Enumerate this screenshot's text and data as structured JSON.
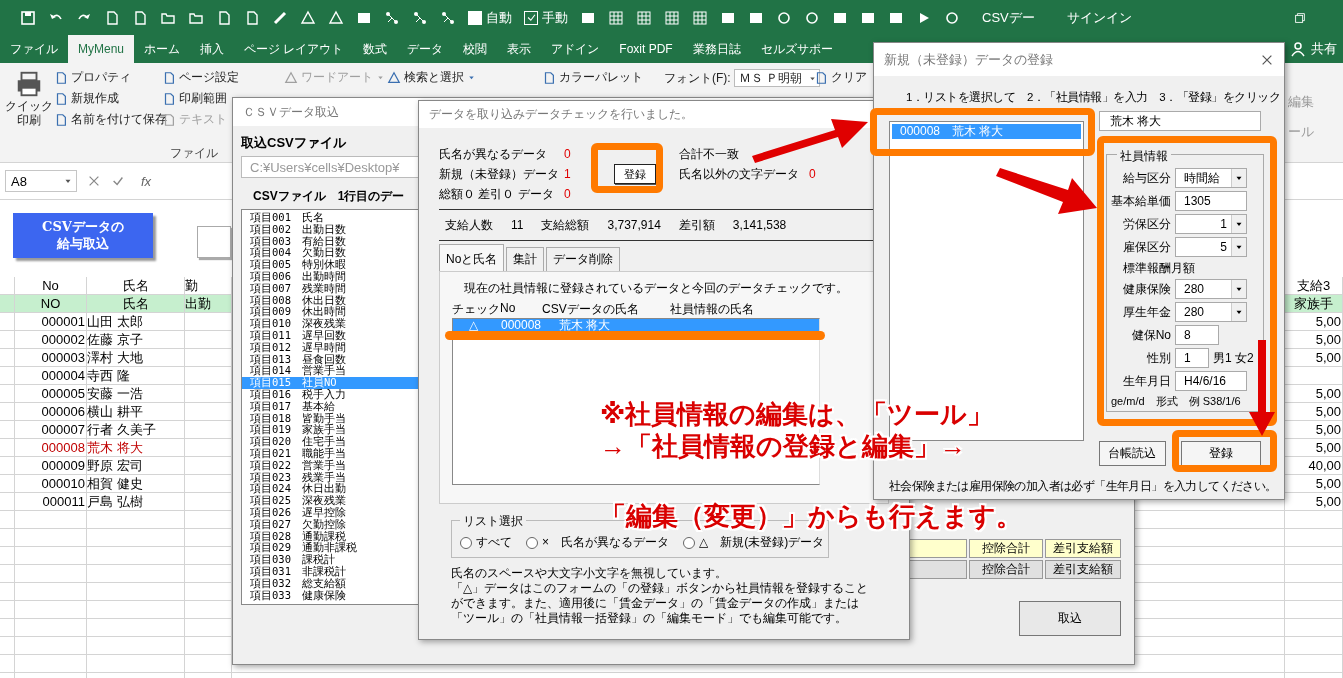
{
  "excel": {
    "title": "CSVデー",
    "signin": "サインイン",
    "share": "共有",
    "toggles": [
      {
        "label": "自動",
        "checked": false
      },
      {
        "label": "手動",
        "checked": true
      }
    ],
    "tabs": [
      {
        "label": "ファイル",
        "selected": false
      },
      {
        "label": "MyMenu",
        "selected": true
      },
      {
        "label": "ホーム",
        "selected": false
      },
      {
        "label": "挿入",
        "selected": false
      },
      {
        "label": "ページ レイアウト",
        "selected": false
      },
      {
        "label": "数式",
        "selected": false
      },
      {
        "label": "データ",
        "selected": false
      },
      {
        "label": "校閲",
        "selected": false
      },
      {
        "label": "表示",
        "selected": false
      },
      {
        "label": "アドイン",
        "selected": false
      },
      {
        "label": "Foxit PDF",
        "selected": false
      },
      {
        "label": "業務日誌",
        "selected": false
      },
      {
        "label": "セルズサポー",
        "selected": false
      }
    ]
  },
  "ribbon": {
    "columns": [
      [
        {
          "label": "クイック印刷",
          "kind": "large",
          "disabled": false
        }
      ],
      [
        {
          "label": "プロパティ",
          "kind": "small",
          "disabled": false
        },
        {
          "label": "新規作成",
          "kind": "small",
          "disabled": false
        },
        {
          "label": "名前を付けて保存",
          "kind": "small",
          "disabled": false
        }
      ],
      [
        {
          "label": "ページ設定",
          "kind": "small",
          "disabled": false
        },
        {
          "label": "印刷範囲",
          "kind": "small",
          "disabled": false
        },
        {
          "label": "テキスト",
          "kind": "small",
          "disabled": true
        }
      ],
      [
        {
          "label": "ワードアート",
          "kind": "menu",
          "disabled": true
        }
      ],
      [
        {
          "label": "検索と選択",
          "kind": "menu",
          "disabled": false
        }
      ],
      [
        {
          "label": "カラーパレット",
          "kind": "small",
          "disabled": false
        }
      ],
      [
        {
          "label": "フォント(F):",
          "kind": "font",
          "value": "ＭＳ Ｐ明朝",
          "disabled": false
        }
      ],
      [
        {
          "label": "クリア",
          "kind": "small",
          "disabled": false
        }
      ]
    ],
    "group_label": "ファイル",
    "partial": [
      "編集",
      "ール"
    ]
  },
  "formula_bar": {
    "name_box": "A8",
    "fx": "fx"
  },
  "sheet": {
    "button": "CSVデータの給与取込",
    "headers": [
      {
        "cells": [
          "No",
          "氏名",
          "勤",
          "支給3"
        ],
        "highlight": false
      },
      {
        "cells": [
          "NO",
          "氏名",
          "出勤",
          "家族手"
        ],
        "highlight": true
      }
    ],
    "rows": [
      {
        "no": "000001",
        "name": "山田 太郎",
        "amount": "5,00",
        "unregistered": false
      },
      {
        "no": "000002",
        "name": "佐藤 京子",
        "amount": "5,00",
        "unregistered": false
      },
      {
        "no": "000003",
        "name": "澤村 大地",
        "amount": "5,00",
        "unregistered": false
      },
      {
        "no": "000004",
        "name": "寺西 隆",
        "unregistered": false
      },
      {
        "no": "000005",
        "name": "安藤 一浩",
        "amount": "5,00",
        "unregistered": false
      },
      {
        "no": "000006",
        "name": "横山 耕平",
        "amount": "5,00",
        "unregistered": false
      },
      {
        "no": "000007",
        "name": "行者 久美子",
        "amount": "5,00",
        "unregistered": false
      },
      {
        "no": "000008",
        "name": "荒木 将大",
        "amount": "5,00",
        "unregistered": true
      },
      {
        "no": "000009",
        "name": "野原 宏司",
        "amount": "40,00",
        "unregistered": false
      },
      {
        "no": "000010",
        "name": "相賀 健史",
        "amount": "5,00",
        "unregistered": false
      },
      {
        "no": "000011",
        "name": "戸島 弘樹",
        "amount": "5,00",
        "unregistered": false
      }
    ]
  },
  "csv_window": {
    "title": "ＣＳＶデータ取込",
    "file_label": "取込CSVファイル",
    "file_path": "C:¥Users¥cells¥Desktop¥",
    "list_label": "CSVファイル　1行目のデー",
    "fields": [
      {
        "no": "項目001",
        "name": "氏名",
        "selected": false
      },
      {
        "no": "項目002",
        "name": "出勤日数",
        "selected": false
      },
      {
        "no": "項目003",
        "name": "有給日数",
        "selected": false
      },
      {
        "no": "項目004",
        "name": "欠勤日数",
        "selected": false
      },
      {
        "no": "項目005",
        "name": "特別休暇",
        "selected": false
      },
      {
        "no": "項目006",
        "name": "出勤時間",
        "selected": false
      },
      {
        "no": "項目007",
        "name": "残業時間",
        "selected": false
      },
      {
        "no": "項目008",
        "name": "休出日数",
        "selected": false
      },
      {
        "no": "項目009",
        "name": "休出時間",
        "selected": false
      },
      {
        "no": "項目010",
        "name": "深夜残業",
        "selected": false
      },
      {
        "no": "項目011",
        "name": "遅早回数",
        "selected": false
      },
      {
        "no": "項目012",
        "name": "遅早時間",
        "selected": false
      },
      {
        "no": "項目013",
        "name": "昼食回数",
        "selected": false
      },
      {
        "no": "項目014",
        "name": "営業手当",
        "selected": false
      },
      {
        "no": "項目015",
        "name": "社員NO",
        "selected": true
      },
      {
        "no": "項目016",
        "name": "税手入力",
        "selected": false
      },
      {
        "no": "項目017",
        "name": "基本給",
        "selected": false
      },
      {
        "no": "項目018",
        "name": "皆勤手当",
        "selected": false
      },
      {
        "no": "項目019",
        "name": "家族手当",
        "selected": false
      },
      {
        "no": "項目020",
        "name": "住宅手当",
        "selected": false
      },
      {
        "no": "項目021",
        "name": "職能手当",
        "selected": false
      },
      {
        "no": "項目022",
        "name": "営業手当",
        "selected": false
      },
      {
        "no": "項目023",
        "name": "残業手当",
        "selected": false
      },
      {
        "no": "項目024",
        "name": "休日出勤",
        "selected": false
      },
      {
        "no": "項目025",
        "name": "深夜残業",
        "selected": false
      },
      {
        "no": "項目026",
        "name": "遅早控除",
        "selected": false
      },
      {
        "no": "項目027",
        "name": "欠勤控除",
        "selected": false
      },
      {
        "no": "項目028",
        "name": "通勤課税",
        "selected": false
      },
      {
        "no": "項目029",
        "name": "通勤非課税",
        "selected": false
      },
      {
        "no": "項目030",
        "name": "課税計",
        "selected": false
      },
      {
        "no": "項目031",
        "name": "非課税計",
        "selected": false
      },
      {
        "no": "項目032",
        "name": "総支給額",
        "selected": false
      },
      {
        "no": "項目033",
        "name": "健康保険",
        "selected": false
      }
    ],
    "summary_rows": [
      {
        "cells": [
          "控除合計",
          "差引支給額"
        ],
        "highlight": true
      },
      {
        "cells": [
          "控除合計",
          "差引支給額"
        ],
        "highlight": false
      }
    ],
    "import_button": "取込"
  },
  "check_dialog": {
    "title": "データを取り込みデータチェックを行いました。",
    "checks_left": [
      {
        "label": "氏名が異なるデータ",
        "count": "0"
      },
      {
        "label": "新規（未登録）データ",
        "count": "1"
      },
      {
        "label": "総額０ 差引０ データ",
        "count": "0"
      }
    ],
    "register_button": "登録",
    "checks_right": [
      {
        "label": "合計不一致"
      },
      {
        "label": "氏名以外の文字データ",
        "count": "0"
      }
    ],
    "totals": [
      {
        "label": "支給人数",
        "value": "11"
      },
      {
        "label": "支給総額",
        "value": "3,737,914"
      },
      {
        "label": "差引額",
        "value": "3,141,538"
      }
    ],
    "tabs": [
      {
        "label": "Noと氏名",
        "selected": true
      },
      {
        "label": "集計",
        "selected": false
      },
      {
        "label": "データ削除",
        "selected": false
      }
    ],
    "description": "現在の社員情報に登録されているデータと今回のデータチェックです。",
    "columns": [
      "チェック",
      "No",
      "CSVデータの氏名",
      "社員情報の氏名"
    ],
    "rows": [
      {
        "check": "△",
        "no": "000008",
        "csv_name": "荒木 将大",
        "selected": true
      }
    ],
    "filter": {
      "title": "リスト選択",
      "options": [
        {
          "label": "すべて",
          "selected": false
        },
        {
          "label": "×　氏名が異なるデータ",
          "selected": false
        },
        {
          "label": "△　新規(未登録)データ",
          "selected": false
        }
      ]
    },
    "notes": [
      "氏名のスペースや大文字小文字を無視しています。",
      "「△」データはこのフォームの「の登録」ボタンから社員情報を登録することができます。また、適用後に「賃金データ」の「賃金データの作成」または「ツール」の「社員情報一括登録」の「編集モード」でも編集可能です。"
    ]
  },
  "register_dialog": {
    "title": "新規（未登録）データの登録",
    "instruction": "1．リストを選択して　2．「社員情報」を入力　3．「登録」をクリック",
    "list": [
      {
        "label": "000008　荒木 将大",
        "selected": true
      }
    ],
    "name": "荒木 将大",
    "group_title": "社員情報",
    "fields": [
      {
        "label": "給与区分",
        "value": "時間給",
        "kind": "dropdown"
      },
      {
        "label": "基本給単価",
        "value": "1305",
        "kind": "text"
      },
      {
        "label": "労保区分",
        "value": "1",
        "kind": "number_dropdown"
      },
      {
        "label": "雇保区分",
        "value": "5",
        "kind": "number_dropdown"
      },
      {
        "label": "標準報酬月額",
        "kind": "heading"
      },
      {
        "label": "健康保険",
        "value": "280",
        "kind": "dropdown"
      },
      {
        "label": "厚生年金",
        "value": "280",
        "kind": "dropdown"
      },
      {
        "label": "健保No",
        "value": "8",
        "kind": "short"
      },
      {
        "label": "性別",
        "value": "1",
        "kind": "tiny",
        "suffix": "男1 女2"
      },
      {
        "label": "生年月日",
        "value": "H4/6/16",
        "kind": "text"
      }
    ],
    "format_hint": "ge/m/d　形式　例 S38/1/6",
    "buttons": [
      "台帳読込",
      "登録"
    ],
    "note": "社会保険または雇用保険の加入者は必ず「生年月日」を入力してください。"
  },
  "annotation": [
    "※社員情報の編集は、「ツール」",
    "→「社員情報の登録と編集」→",
    "「編集（変更）」からも行えます。"
  ]
}
